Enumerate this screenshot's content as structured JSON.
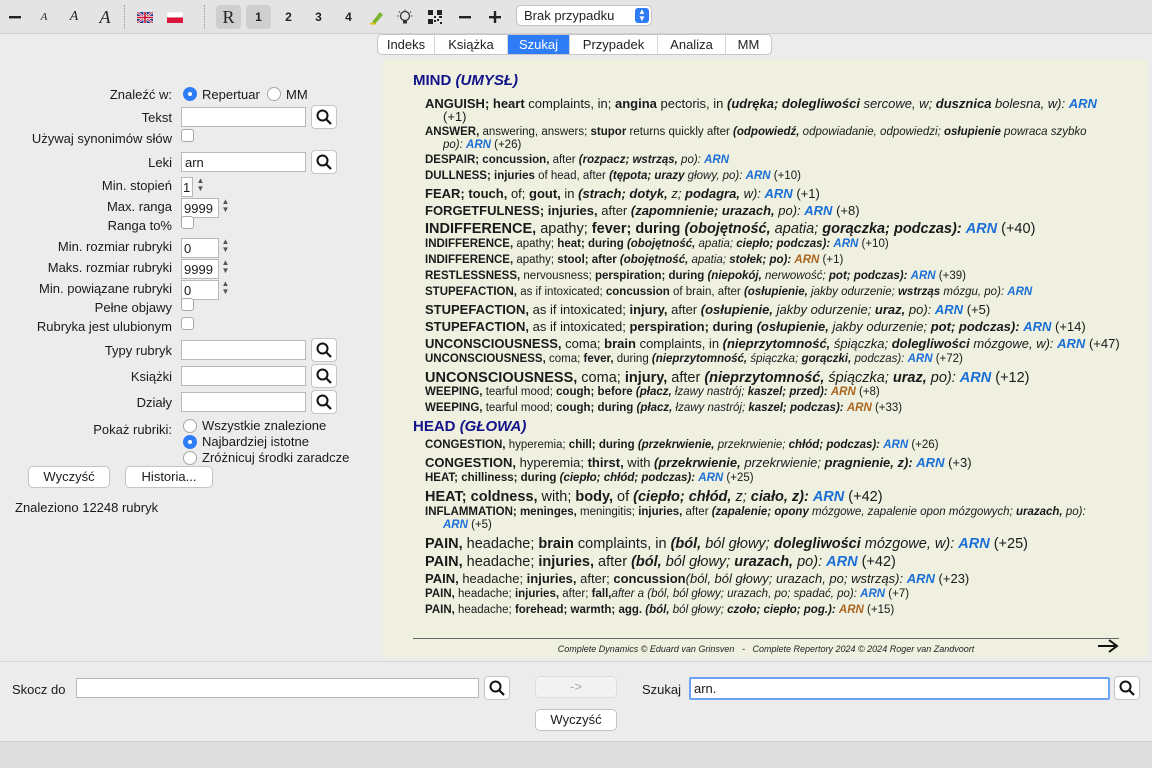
{
  "toolbar": {
    "items": [
      "zoom-out",
      "font-small",
      "font-medium",
      "font-large",
      "flag-en",
      "flag-pl",
      "R",
      "1",
      "2",
      "3",
      "4",
      "highlighter",
      "lightbulb",
      "qr",
      "minus",
      "plus"
    ],
    "btn_r": "R",
    "btn_1": "1",
    "btn_2": "2",
    "btn_3": "3",
    "btn_4": "4",
    "case_select": "Brak przypadku"
  },
  "tabs": [
    "Indeks",
    "Książka",
    "Szukaj",
    "Przypadek",
    "Analiza",
    "MM"
  ],
  "active_tab": "Szukaj",
  "search_form": {
    "find_in_label": "Znaleźć w:",
    "opt_repertory": "Repertuar",
    "opt_mm": "MM",
    "text_label": "Tekst",
    "text_value": "",
    "synonyms_label": "Używaj synonimów słów",
    "remedies_label": "Leki",
    "remedies_value": "arn",
    "min_degree_label": "Min. stopień",
    "min_degree_value": "1",
    "max_rank_label": "Max. ranga",
    "max_rank_value": "9999",
    "rank_pct_label": "Ranga to%",
    "min_rubric_size_label": "Min. rozmiar rubryki",
    "min_rubric_size_value": "0",
    "max_rubric_size_label": "Maks. rozmiar rubryki",
    "max_rubric_size_value": "9999",
    "min_related_label": "Min. powiązane rubryki",
    "min_related_value": "0",
    "full_symptoms_label": "Pełne objawy",
    "favourite_label": "Rubryka jest ulubionym",
    "rubric_types_label": "Typy rubryk",
    "books_label": "Książki",
    "sections_label": "Działy",
    "show_label": "Pokaż rubriki:",
    "show_all": "Wszystkie znalezione",
    "show_relevant": "Najbardziej istotne",
    "show_diff": "Zróżnicuj środki zaradcze",
    "clear_btn": "Wyczyść",
    "history_btn": "Historia...",
    "found_text": "Znaleziono 12248 rubryk"
  },
  "results": {
    "chapters": [
      {
        "name": "MIND",
        "trans": "(UMYSŁ)"
      },
      {
        "name": "HEAD",
        "trans": "(GŁOWA)"
      }
    ],
    "lines": [
      {
        "size": "mid",
        "rubric": "ANGUISH; heart",
        "text": " complaints, in; ",
        "r2": "angina",
        "t2": " pectoris, in ",
        "trans": "(udręka; dolegliwości",
        "trans2": " sercowe, w; ",
        "trans3": "dusznica",
        "trans4": " bolesna, w):",
        "rem": "ARN",
        "cls": "",
        "extra": "",
        "wrap": "(+1)"
      },
      {
        "size": "small",
        "rubric": "ANSWER,",
        "text": " answering, answers; ",
        "r2": "stupor",
        "t2": " returns quickly after ",
        "trans": "(odpowiedź,",
        "trans2": " odpowiadanie, odpowiedzi; ",
        "trans3": "osłupienie",
        "trans4": " powraca szybko",
        "rem": "",
        "cls": "",
        "extra": "",
        "wrap": "po): ARN (+26)"
      },
      {
        "size": "small",
        "rubric": "DESPAIR; concussion,",
        "text": " after ",
        "r2": "",
        "t2": "",
        "trans": "(rozpacz; wstrząs,",
        "trans2": " po):",
        "trans3": "",
        "trans4": "",
        "rem": "ARN",
        "cls": "",
        "extra": "",
        "wrap": ""
      },
      {
        "size": "small",
        "rubric": "DULLNESS; injuries",
        "text": " of head, after ",
        "r2": "",
        "t2": "",
        "trans": "(tępota; urazy",
        "trans2": " głowy, po):",
        "trans3": "",
        "trans4": "",
        "rem": "ARN",
        "cls": "",
        "extra": "(+10)",
        "wrap": ""
      },
      {
        "size": "mid",
        "rubric": "FEAR; touch,",
        "text": " of; ",
        "r2": "gout,",
        "t2": " in ",
        "trans": "(strach; dotyk,",
        "trans2": " z; ",
        "trans3": "podagra,",
        "trans4": " w):",
        "rem": "ARN",
        "cls": "",
        "extra": "(+1)",
        "wrap": ""
      },
      {
        "size": "mid",
        "rubric": "FORGETFULNESS; injuries,",
        "text": " after ",
        "r2": "",
        "t2": "",
        "trans": "(zapomnienie; urazach,",
        "trans2": " po):",
        "trans3": "",
        "trans4": "",
        "rem": "ARN",
        "cls": "",
        "extra": "(+8)",
        "wrap": ""
      },
      {
        "size": "big",
        "rubric": "INDIFFERENCE,",
        "text": " apathy; ",
        "r2": "fever; during",
        "t2": " ",
        "trans": "(obojętność,",
        "trans2": " apatia; ",
        "trans3": "gorączka; podczas):",
        "trans4": "",
        "rem": "ARN",
        "cls": "",
        "extra": "(+40)",
        "wrap": ""
      },
      {
        "size": "small",
        "rubric": "INDIFFERENCE,",
        "text": " apathy; ",
        "r2": "heat; during",
        "t2": " ",
        "trans": "(obojętność,",
        "trans2": " apatia; ",
        "trans3": "ciepło; podczas):",
        "trans4": "",
        "rem": "ARN",
        "cls": "",
        "extra": "(+10)",
        "wrap": ""
      },
      {
        "size": "small",
        "rubric": "INDIFFERENCE,",
        "text": " apathy; ",
        "r2": "stool; after",
        "t2": " ",
        "trans": "(obojętność,",
        "trans2": " apatia; ",
        "trans3": "stołek; po):",
        "trans4": "",
        "rem": "ARN",
        "cls": "b",
        "extra": "(+1)",
        "wrap": ""
      },
      {
        "size": "small",
        "rubric": "RESTLESSNESS,",
        "text": " nervousness; ",
        "r2": "perspiration; during",
        "t2": " ",
        "trans": "(niepokój,",
        "trans2": " nerwowość; ",
        "trans3": "pot; podczas):",
        "trans4": "",
        "rem": "ARN",
        "cls": "",
        "extra": "(+39)",
        "wrap": ""
      },
      {
        "size": "small",
        "rubric": "STUPEFACTION,",
        "text": " as if intoxicated; ",
        "r2": "concussion",
        "t2": " of brain, after ",
        "trans": "(osłupienie,",
        "trans2": " jakby odurzenie; ",
        "trans3": "wstrząs",
        "trans4": " mózgu, po):",
        "rem": "ARN",
        "cls": "",
        "extra": "",
        "wrap": ""
      },
      {
        "size": "mid",
        "rubric": "STUPEFACTION,",
        "text": " as if intoxicated; ",
        "r2": "injury,",
        "t2": " after ",
        "trans": "(osłupienie,",
        "trans2": " jakby odurzenie; ",
        "trans3": "uraz,",
        "trans4": " po):",
        "rem": "ARN",
        "cls": "",
        "extra": "(+5)",
        "wrap": ""
      },
      {
        "size": "mid",
        "rubric": "STUPEFACTION,",
        "text": " as if intoxicated; ",
        "r2": "perspiration; during",
        "t2": " ",
        "trans": "(osłupienie,",
        "trans2": " jakby odurzenie; ",
        "trans3": "pot; podczas):",
        "trans4": "",
        "rem": "ARN",
        "cls": "",
        "extra": "(+14)",
        "wrap": ""
      },
      {
        "size": "mid",
        "rubric": "UNCONSCIOUSNESS,",
        "text": " coma; ",
        "r2": "brain",
        "t2": " complaints, in ",
        "trans": "(nieprzytomność,",
        "trans2": " śpiączka; ",
        "trans3": "dolegliwości",
        "trans4": " mózgowe, w):",
        "rem": "ARN",
        "cls": "",
        "extra": "(+47)",
        "wrap": ""
      },
      {
        "size": "small",
        "rubric": "UNCONSCIOUSNESS,",
        "text": " coma; ",
        "r2": "fever,",
        "t2": " during ",
        "trans": "(nieprzytomność,",
        "trans2": " śpiączka; ",
        "trans3": "gorączki,",
        "trans4": " podczas):",
        "rem": "ARN",
        "cls": "",
        "extra": "(+72)",
        "wrap": ""
      },
      {
        "size": "big",
        "rubric": "UNCONSCIOUSNESS,",
        "text": " coma; ",
        "r2": "injury,",
        "t2": " after ",
        "trans": "(nieprzytomność,",
        "trans2": " śpiączka; ",
        "trans3": "uraz,",
        "trans4": " po):",
        "rem": "ARN",
        "cls": "",
        "extra": "(+12)",
        "wrap": ""
      },
      {
        "size": "small",
        "rubric": "WEEPING,",
        "text": " tearful mood; ",
        "r2": "cough; before",
        "t2": " ",
        "trans": "(płacz,",
        "trans2": " łzawy nastrój; ",
        "trans3": "kaszel; przed):",
        "trans4": "",
        "rem": "ARN",
        "cls": "b",
        "extra": "(+8)",
        "wrap": ""
      },
      {
        "size": "small",
        "rubric": "WEEPING,",
        "text": " tearful mood; ",
        "r2": "cough; during",
        "t2": " ",
        "trans": "(płacz,",
        "trans2": " łzawy nastrój; ",
        "trans3": "kaszel; podczas):",
        "trans4": "",
        "rem": "ARN",
        "cls": "b",
        "extra": "(+33)",
        "wrap": ""
      },
      {
        "size": "small",
        "rubric": "CONGESTION,",
        "text": " hyperemia; ",
        "r2": "chill; during",
        "t2": " ",
        "trans": "(przekrwienie,",
        "trans2": " przekrwienie; ",
        "trans3": "chłód; podczas):",
        "trans4": "",
        "rem": "ARN",
        "cls": "",
        "extra": "(+26)",
        "wrap": ""
      },
      {
        "size": "mid",
        "rubric": "CONGESTION,",
        "text": " hyperemia; ",
        "r2": "thirst,",
        "t2": " with ",
        "trans": "(przekrwienie,",
        "trans2": " przekrwienie; ",
        "trans3": "pragnienie, z):",
        "trans4": "",
        "rem": "ARN",
        "cls": "",
        "extra": "(+3)",
        "wrap": ""
      },
      {
        "size": "small",
        "rubric": "HEAT; chilliness; during",
        "text": " ",
        "r2": "",
        "t2": "",
        "trans": "(ciepło; chłód; podczas):",
        "trans2": "",
        "trans3": "",
        "trans4": "",
        "rem": "ARN",
        "cls": "",
        "extra": "(+25)",
        "wrap": ""
      },
      {
        "size": "big",
        "rubric": "HEAT; coldness,",
        "text": " with; ",
        "r2": "body,",
        "t2": " of ",
        "trans": "(ciepło; chłód,",
        "trans2": " z; ",
        "trans3": "ciało, z):",
        "trans4": "",
        "rem": "ARN",
        "cls": "",
        "extra": "(+42)",
        "wrap": ""
      },
      {
        "size": "small",
        "rubric": "INFLAMMATION; meninges,",
        "text": " meningitis; ",
        "r2": "injuries,",
        "t2": " after ",
        "trans": "(zapalenie; opony",
        "trans2": " mózgowe, zapalenie opon mózgowych; ",
        "trans3": "urazach,",
        "trans4": " po):",
        "rem": "",
        "cls": "",
        "extra": "",
        "wrap": "ARN (+5)"
      },
      {
        "size": "big",
        "rubric": "PAIN,",
        "text": " headache; ",
        "r2": "brain",
        "t2": " complaints, in ",
        "trans": "(ból,",
        "trans2": " ból głowy; ",
        "trans3": "dolegliwości",
        "trans4": " mózgowe, w):",
        "rem": "ARN",
        "cls": "",
        "extra": "(+25)",
        "wrap": ""
      },
      {
        "size": "big",
        "rubric": "PAIN,",
        "text": " headache; ",
        "r2": "injuries,",
        "t2": " after ",
        "trans": "(ból,",
        "trans2": " ból głowy; ",
        "trans3": "urazach,",
        "trans4": " po):",
        "rem": "ARN",
        "cls": "",
        "extra": "(+42)",
        "wrap": ""
      },
      {
        "size": "mid",
        "rubric": "PAIN,",
        "text": " headache; ",
        "r2": "injuries,",
        "t2": " after; ",
        "trans": "",
        "trans2": "",
        "trans3": "",
        "trans4": "",
        "r3": "concussion",
        "rem": "ARN",
        "cls": "",
        "extra": "(+23)",
        "wrap": "",
        "trans_alt": "(ból, ból głowy; urazach, po; wstrząs):"
      },
      {
        "size": "small",
        "rubric": "PAIN,",
        "text": " headache; ",
        "r2": "injuries,",
        "t2": " after; ",
        "trans": "",
        "trans2": "",
        "trans3": "",
        "trans4": "",
        "r3": "fall,",
        "rem": "ARN",
        "cls": "",
        "extra": "(+7)",
        "wrap": "",
        "trans_alt": "after a (ból, ból głowy; urazach, po; spadać, po):"
      },
      {
        "size": "small",
        "rubric": "PAIN,",
        "text": " headache; ",
        "r2": "forehead; warmth; agg.",
        "t2": " ",
        "trans": "(ból,",
        "trans2": " ból głowy; ",
        "trans3": "czoło; ciepło; pog.):",
        "trans4": "",
        "rem": "ARN",
        "cls": "b",
        "extra": "(+15)",
        "wrap": ""
      }
    ],
    "footer_left": "Complete Dynamics © Eduard van Grinsven",
    "footer_sep": "-",
    "footer_right": "Complete Repertory 2024 © 2024 Roger van Zandvoort"
  },
  "bottom": {
    "jump_label": "Skocz do",
    "jump_value": "",
    "go_btn": "->",
    "search_label": "Szukaj",
    "search_value": "arn.",
    "clear_btn": "Wyczyść"
  }
}
